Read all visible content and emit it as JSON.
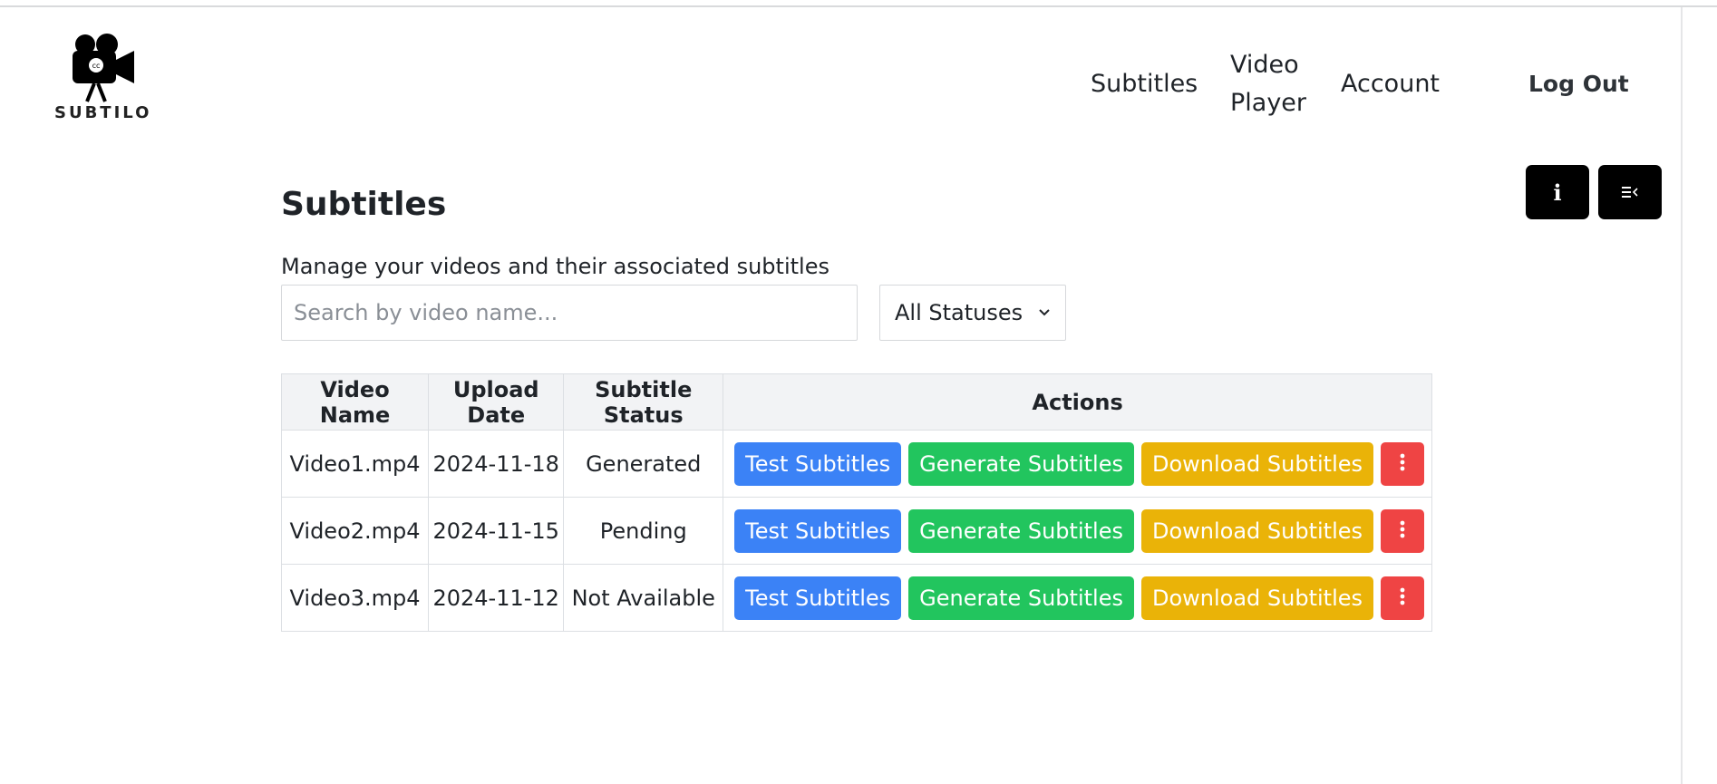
{
  "brand": {
    "name": "SUBTILO",
    "logo_badge": "cc"
  },
  "nav": {
    "subtitles": "Subtitles",
    "video_player": "Video Player",
    "account": "Account",
    "logout": "Log Out"
  },
  "toolbar": {
    "info_glyph": "i"
  },
  "page": {
    "title": "Subtitles",
    "description": "Manage your videos and their associated subtitles"
  },
  "filters": {
    "search_placeholder": "Search by video name...",
    "search_value": "",
    "status_selected": "All Statuses"
  },
  "table": {
    "headers": {
      "video_name": "Video Name",
      "upload_date": "Upload Date",
      "subtitle_status": "Subtitle Status",
      "actions": "Actions"
    },
    "rows": [
      {
        "video_name": "Video1.mp4",
        "upload_date": "2024-11-18",
        "status": "Generated"
      },
      {
        "video_name": "Video2.mp4",
        "upload_date": "2024-11-15",
        "status": "Pending"
      },
      {
        "video_name": "Video3.mp4",
        "upload_date": "2024-11-12",
        "status": "Not Available"
      }
    ],
    "actions": {
      "test": "Test Subtitles",
      "generate": "Generate Subtitles",
      "download": "Download Subtitles"
    }
  },
  "colors": {
    "test_button": "#3b82f6",
    "generate_button": "#22c55e",
    "download_button": "#eab308",
    "more_button": "#ef4444",
    "icon_button": "#000000"
  },
  "icons": {
    "logo": "camera-icon",
    "info": "info-icon",
    "sidebar_toggle": "sidebar-collapse-icon",
    "more": "more-vertical-icon",
    "select": "chevron-down-icon"
  }
}
